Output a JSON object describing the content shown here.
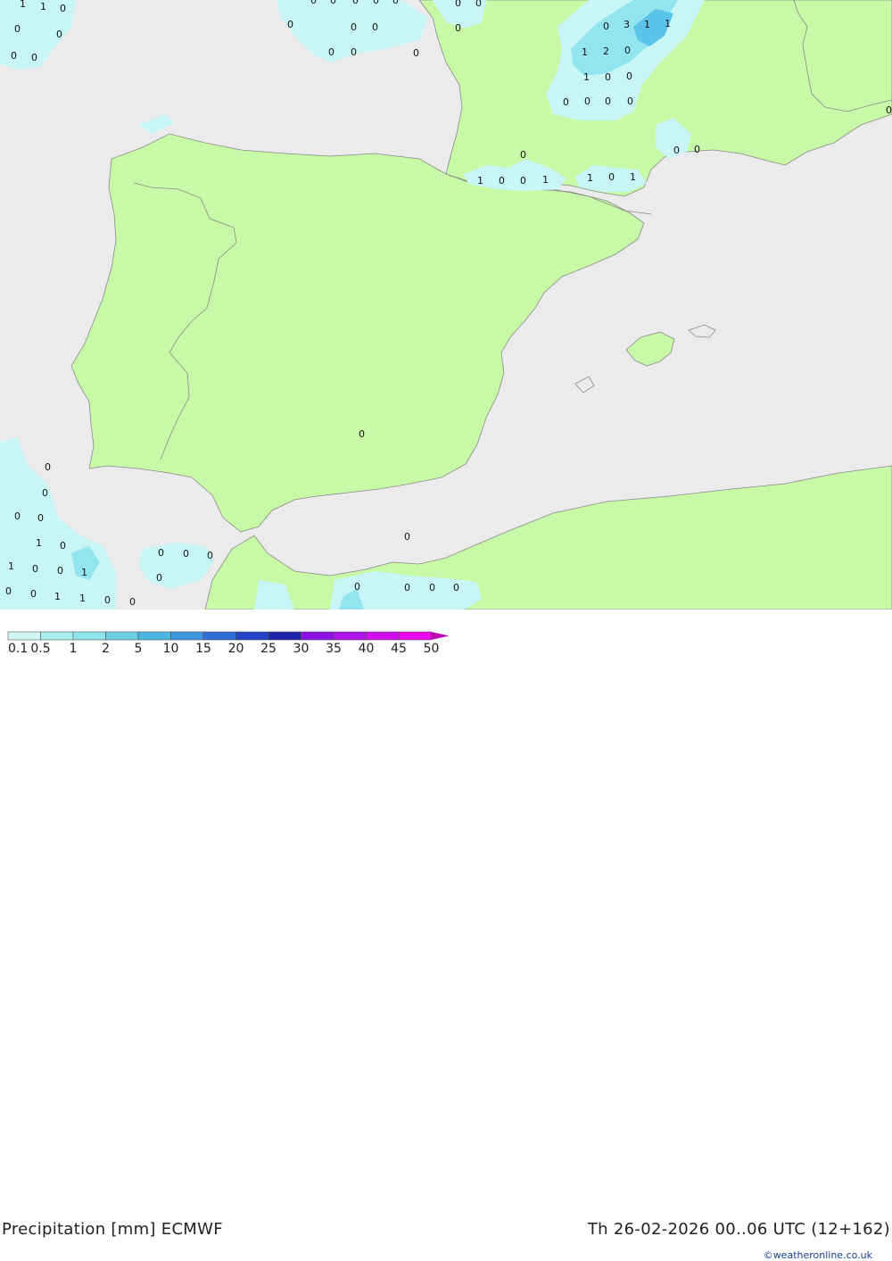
{
  "header": {
    "title": "Precipitation [mm] ECMWF",
    "datetime": "Th 26-02-2026 00..06 UTC (12+162)",
    "credit": "©weatheronline.co.uk"
  },
  "legend": {
    "labels": [
      "0.1",
      "0.5",
      "1",
      "2",
      "5",
      "10",
      "15",
      "20",
      "25",
      "30",
      "35",
      "40",
      "45",
      "50"
    ],
    "colors": [
      "#d2f6f6",
      "#aaeeee",
      "#8ee4ea",
      "#6ccfe6",
      "#4db6e0",
      "#3c96dc",
      "#2f70d8",
      "#2244c6",
      "#1e22a8",
      "#8a10e6",
      "#b012ec",
      "#d20cec",
      "#ec08ea",
      "#be06b4"
    ]
  },
  "colors": {
    "sea": "#ebebeb",
    "land": "#c8f9a6",
    "border": "#8a8a8a",
    "precip_light": "#c8f6f6",
    "precip_mid": "#92e4ee",
    "precip_strong": "#5cc4ea"
  },
  "values": [
    {
      "t": "1"
    },
    {
      "t": "1"
    },
    {
      "t": "0"
    },
    {
      "t": "0"
    },
    {
      "t": "0"
    },
    {
      "t": "0"
    },
    {
      "t": "0"
    },
    {
      "t": "0"
    },
    {
      "t": "0"
    },
    {
      "t": "0"
    },
    {
      "t": "0"
    },
    {
      "t": "0"
    },
    {
      "t": "0"
    },
    {
      "t": "0"
    },
    {
      "t": "0"
    },
    {
      "t": "0"
    },
    {
      "t": "0"
    },
    {
      "t": "0"
    },
    {
      "t": "0"
    },
    {
      "t": "0"
    },
    {
      "t": "0"
    },
    {
      "t": "0"
    },
    {
      "t": "3"
    },
    {
      "t": "1"
    },
    {
      "t": "1"
    },
    {
      "t": "1"
    },
    {
      "t": "2"
    },
    {
      "t": "0"
    },
    {
      "t": "1"
    },
    {
      "t": "0"
    },
    {
      "t": "0"
    },
    {
      "t": "0"
    },
    {
      "t": "0"
    },
    {
      "t": "0"
    },
    {
      "t": "0"
    },
    {
      "t": "0"
    },
    {
      "t": "0"
    },
    {
      "t": "0"
    },
    {
      "t": "1"
    },
    {
      "t": "0"
    },
    {
      "t": "0"
    },
    {
      "t": "1"
    },
    {
      "t": "1"
    },
    {
      "t": "0"
    },
    {
      "t": "1"
    },
    {
      "t": "0"
    },
    {
      "t": "0"
    },
    {
      "t": "0"
    },
    {
      "t": "0"
    },
    {
      "t": "0"
    },
    {
      "t": "0"
    },
    {
      "t": "1"
    },
    {
      "t": "0"
    },
    {
      "t": "0"
    },
    {
      "t": "0"
    },
    {
      "t": "0"
    },
    {
      "t": "1"
    },
    {
      "t": "0"
    },
    {
      "t": "0"
    },
    {
      "t": "1"
    },
    {
      "t": "0"
    },
    {
      "t": "0"
    },
    {
      "t": "1"
    },
    {
      "t": "1"
    },
    {
      "t": "0"
    },
    {
      "t": "0"
    },
    {
      "t": "0"
    },
    {
      "t": "0"
    },
    {
      "t": "0"
    },
    {
      "t": "0"
    },
    {
      "t": "0"
    },
    {
      "t": "0"
    }
  ]
}
